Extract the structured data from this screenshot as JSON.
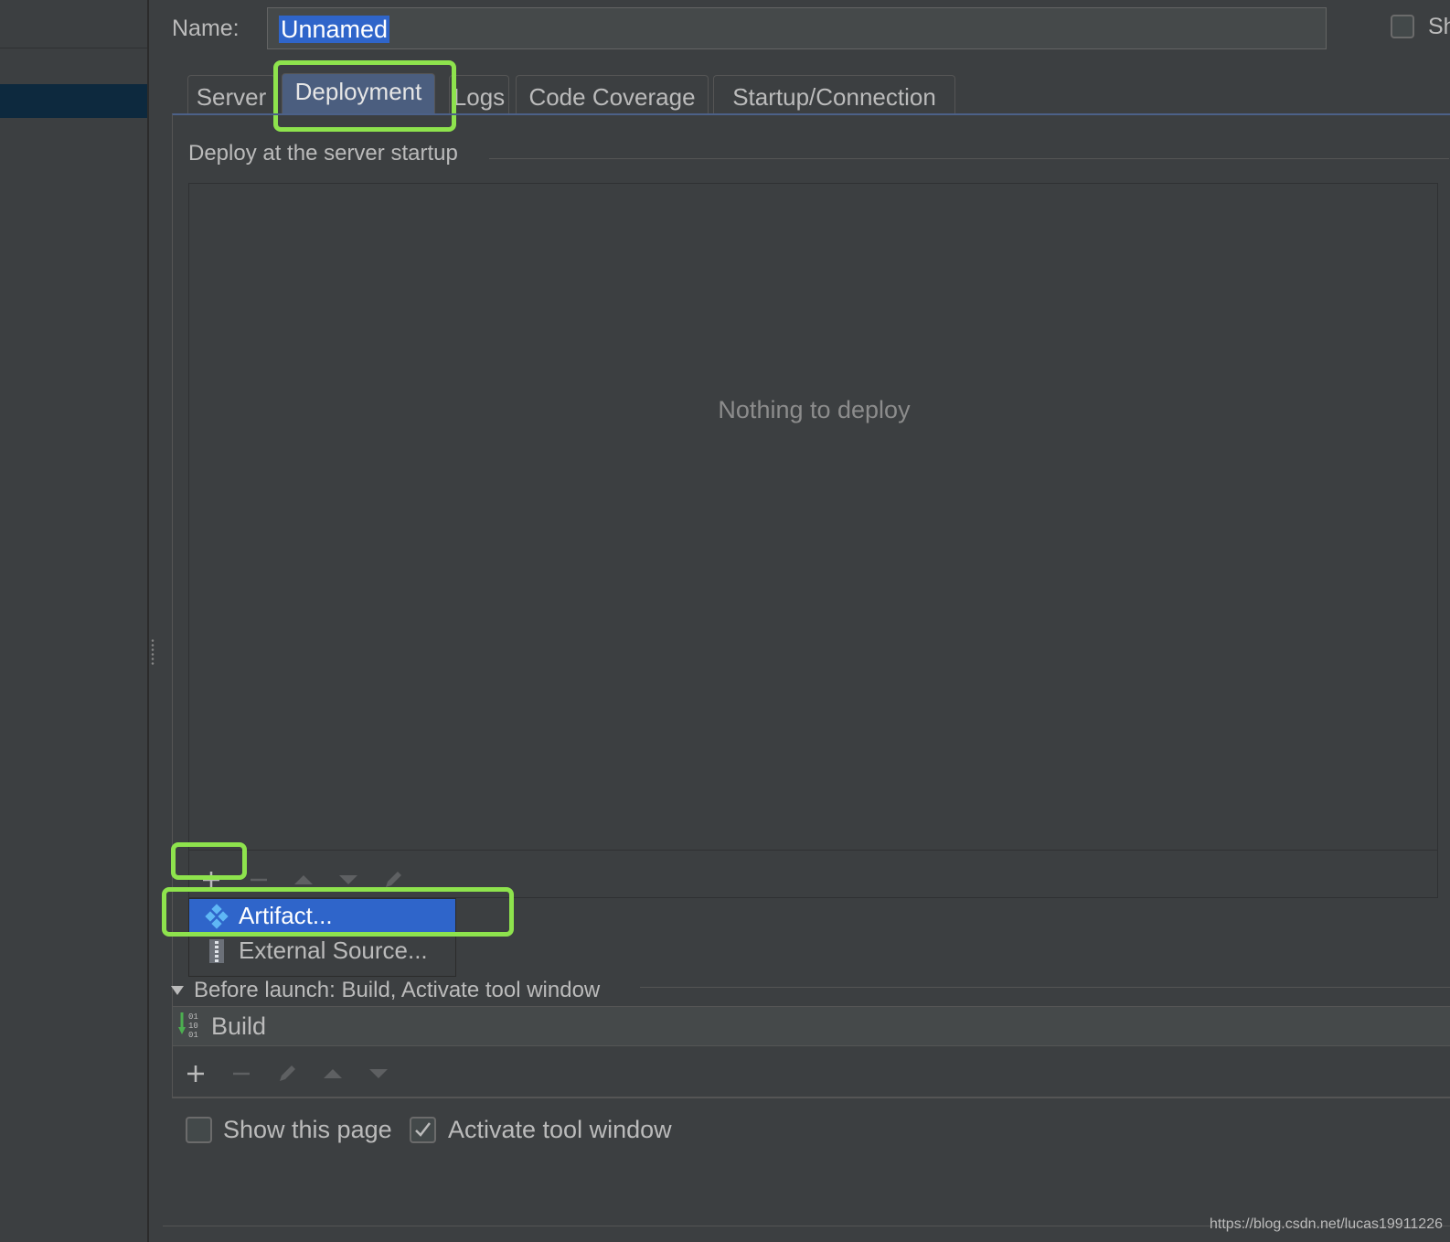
{
  "header": {
    "name_label": "Name:",
    "name_value": "Unnamed",
    "share_label": "Sh"
  },
  "tabs": [
    {
      "label": "Server",
      "active": false
    },
    {
      "label": "Deployment",
      "active": true
    },
    {
      "label": "Logs",
      "active": false
    },
    {
      "label": "Code Coverage",
      "active": false
    },
    {
      "label": "Startup/Connection",
      "active": false
    }
  ],
  "deployment": {
    "section_title": "Deploy at the server startup",
    "empty_text": "Nothing to deploy",
    "toolbar_icons": [
      "plus-icon",
      "minus-icon",
      "arrow-up-icon",
      "arrow-down-icon",
      "pencil-icon"
    ]
  },
  "add_menu": {
    "items": [
      {
        "label": "Artifact...",
        "icon": "artifact-icon",
        "selected": true
      },
      {
        "label": "External Source...",
        "icon": "archive-icon",
        "selected": false
      }
    ]
  },
  "before_launch": {
    "title": "Before launch: Build, Activate tool window",
    "tasks": [
      {
        "label": "Build",
        "icon": "build-icon"
      }
    ],
    "toolbar_icons": [
      "plus-icon",
      "minus-icon",
      "pencil-icon",
      "arrow-up-icon",
      "arrow-down-icon"
    ]
  },
  "options": {
    "show_page": {
      "label": "Show this page",
      "checked": false
    },
    "activate_tool_window": {
      "label": "Activate tool window",
      "checked": true
    }
  },
  "watermark": "https://blog.csdn.net/lucas19911226",
  "colors": {
    "background": "#3c3f41",
    "selection": "#2f65ca",
    "highlight": "#8ee34d",
    "active_tab": "#4b5e7f"
  }
}
